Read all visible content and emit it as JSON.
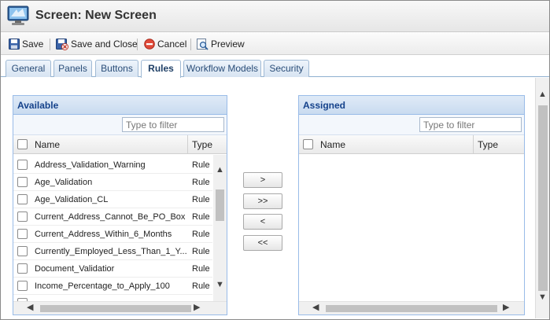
{
  "window": {
    "title": "Screen: New Screen",
    "icon": "screen-monitor-icon"
  },
  "toolbar": {
    "save_label": "Save",
    "save_close_label": "Save and Close",
    "cancel_label": "Cancel",
    "preview_label": "Preview"
  },
  "tabs": [
    {
      "label": "General"
    },
    {
      "label": "Panels"
    },
    {
      "label": "Buttons"
    },
    {
      "label": "Rules"
    },
    {
      "label": "Workflow Models"
    },
    {
      "label": "Security"
    }
  ],
  "active_tab": "Rules",
  "available": {
    "title": "Available",
    "filter_placeholder": "Type to filter",
    "col_name": "Name",
    "col_type": "Type",
    "rows": [
      {
        "name": "Address_Validation_Warning",
        "type": "Rule"
      },
      {
        "name": "Age_Validation",
        "type": "Rule"
      },
      {
        "name": "Age_Validation_CL",
        "type": "Rule"
      },
      {
        "name": "Current_Address_Cannot_Be_PO_Box",
        "type": "Rule"
      },
      {
        "name": "Current_Address_Within_6_Months",
        "type": "Rule"
      },
      {
        "name": "Currently_Employed_Less_Than_1_Y...",
        "type": "Rule"
      },
      {
        "name": "Document_Validatior",
        "type": "Rule"
      },
      {
        "name": "Income_Percentage_to_Apply_100",
        "type": "Rule"
      }
    ]
  },
  "assigned": {
    "title": "Assigned",
    "filter_placeholder": "Type to filter",
    "col_name": "Name",
    "col_type": "Type"
  },
  "move_buttons": {
    "add": ">",
    "add_all": ">>",
    "remove": "<",
    "remove_all": "<<"
  },
  "colors": {
    "panel_header": "#c9dbf0",
    "panel_title": "#15428b",
    "tab_text": "#2a4d78"
  }
}
